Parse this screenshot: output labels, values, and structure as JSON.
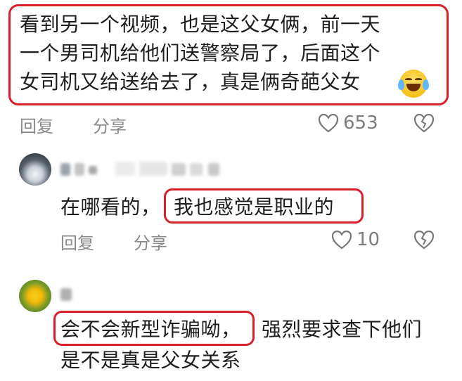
{
  "comments": [
    {
      "lines": [
        "看到另一个视频，也是这父女俩，前一天",
        "一个男司机给他们送警察局了，后面这个",
        "女司机又给送给去了，真是俩奇葩父女"
      ],
      "emoji": "laughing-tears-emoji",
      "reply_label": "回复",
      "share_label": "分享",
      "like_count": "653"
    },
    {
      "text_prefix": "在哪看的，",
      "text_highlight": "我也感觉是职业的",
      "reply_label": "回复",
      "share_label": "分享",
      "like_count": "10"
    },
    {
      "text_highlight": "会不会新型诈骗呦，",
      "text_rest_line1": "强烈要求查下他们",
      "text_line2": "是不是真是父女关系"
    }
  ],
  "colors": {
    "highlight": "#d8202b",
    "action_text": "#8a8a8a",
    "body_text": "#1d1d1d"
  },
  "icons": [
    "heart-outline-icon",
    "broken-heart-icon"
  ]
}
